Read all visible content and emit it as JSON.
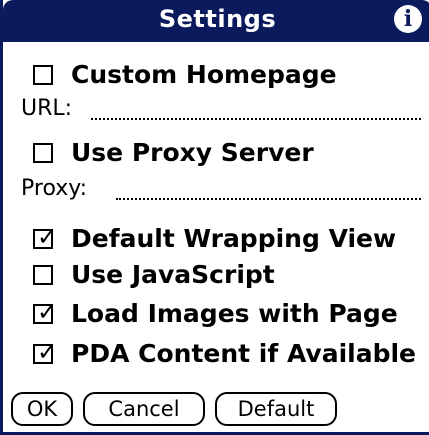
{
  "title": "Settings",
  "info_icon": "info-icon",
  "custom_homepage": {
    "label": "Custom Homepage",
    "checked": false
  },
  "url": {
    "label": "URL:",
    "value": ""
  },
  "use_proxy": {
    "label": "Use Proxy Server",
    "checked": false
  },
  "proxy": {
    "label": "Proxy:",
    "value": ""
  },
  "default_wrapping": {
    "label": "Default Wrapping View",
    "checked": true
  },
  "use_javascript": {
    "label": "Use JavaScript",
    "checked": false
  },
  "load_images": {
    "label": "Load Images with Page",
    "checked": true
  },
  "pda_content": {
    "label": "PDA Content if Available",
    "checked": true
  },
  "buttons": {
    "ok": "OK",
    "cancel": "Cancel",
    "default": "Default"
  },
  "check_glyph": "✓",
  "colors": {
    "titlebar": "#0a1a5c",
    "background": "#ffffff"
  }
}
